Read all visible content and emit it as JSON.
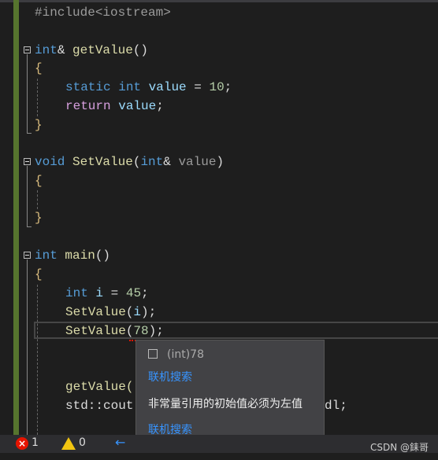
{
  "code": {
    "include": "#include<iostream>",
    "getValue_sig": [
      "int",
      "& ",
      "getValue",
      "()"
    ],
    "static_line": [
      "static",
      " ",
      "int",
      " ",
      "value",
      " = ",
      "10",
      ";"
    ],
    "return_line": [
      "return",
      " ",
      "value",
      ";"
    ],
    "setValue_sig": [
      "void",
      " ",
      "SetValue",
      "(",
      "int",
      "& ",
      "value",
      ")"
    ],
    "main_sig": [
      "int",
      " ",
      "main",
      "()"
    ],
    "int_i": [
      "int",
      " ",
      "i",
      " = ",
      "45",
      ";"
    ],
    "set_i": [
      "SetValue",
      "(",
      "i",
      ");"
    ],
    "set_78": [
      "SetValue",
      "(",
      "78",
      ");"
    ],
    "get_call": "getValue()",
    "cout_start": "std::cout",
    "cout_end": "dl;",
    "open_brace": "{",
    "close_brace": "}"
  },
  "tooltip": {
    "signature": "(int)78",
    "search_link_1": "联机搜索",
    "error_message": "非常量引用的初始值必须为左值",
    "search_link_2": "联机搜索"
  },
  "status": {
    "error_count": "1",
    "warning_count": "0",
    "back_arrow": "←",
    "forward_arrow": "→"
  },
  "watermark": "CSDN @銇哥",
  "colors": {
    "keyword": "#569cd6",
    "function": "#dcdcaa",
    "error": "#e51400",
    "link": "#3794ff"
  }
}
